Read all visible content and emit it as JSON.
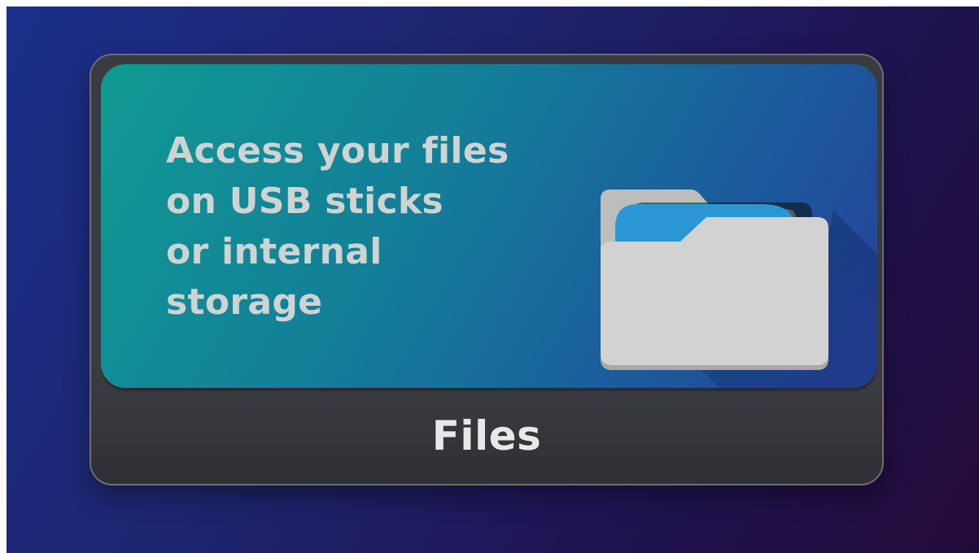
{
  "tile": {
    "label": "Files",
    "description_lines": [
      "Access your files",
      "on USB sticks",
      "or internal",
      "storage"
    ],
    "icon": "folder-icon"
  },
  "colors": {
    "background_start": "#1b2f8a",
    "background_end": "#220a38",
    "hero_start": "#0f9a93",
    "hero_end": "#253e9a",
    "tile_body": "#3a3b40",
    "folder_front": "#d2d2d2",
    "folder_tab": "#2a97d4",
    "text": "#cfd3d2"
  }
}
